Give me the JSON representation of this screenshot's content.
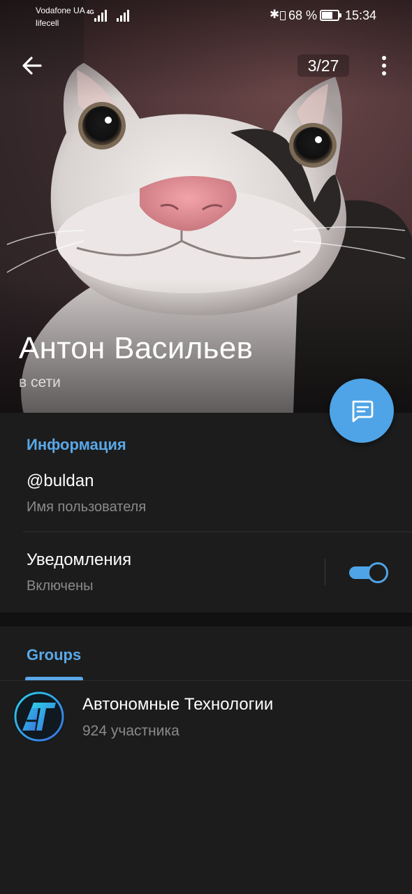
{
  "status_bar": {
    "carrier_1": "Vodafone UA",
    "carrier_2": "lifecell",
    "network_type": "4G",
    "battery_percent": "68 %",
    "battery_level": 0.68,
    "time": "15:34"
  },
  "top_bar": {
    "photo_counter": "3/27",
    "back_icon": "arrow-left-icon",
    "menu_icon": "more-vertical-icon"
  },
  "profile": {
    "name": "Антон Васильев",
    "status": "в сети",
    "photo": "cat-photo"
  },
  "fab": {
    "icon": "message-icon",
    "color": "#4ea4e6"
  },
  "info_section": {
    "title": "Информация",
    "username": "@buldan",
    "username_label": "Имя пользователя",
    "notifications_label": "Уведомления",
    "notifications_state": "Включены",
    "notifications_on": true
  },
  "groups_section": {
    "tab_label": "Groups",
    "items": [
      {
        "name": "Автономные Технологии",
        "members": "924 участника",
        "avatar_text": "AT"
      }
    ]
  },
  "colors": {
    "accent": "#4ea4e6",
    "section_title": "#5aa8e8",
    "background": "#1c1c1c",
    "secondary_text": "#8a8a8a"
  }
}
